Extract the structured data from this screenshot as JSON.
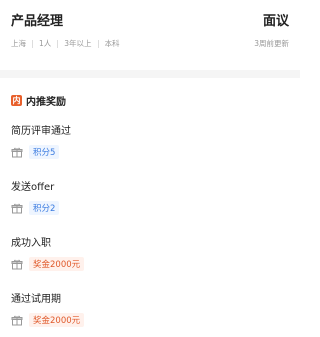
{
  "header": {
    "title": "产品经理",
    "salary": "面议",
    "meta": [
      "上海",
      "1人",
      "3年以上",
      "本科"
    ],
    "updated": "3周前更新"
  },
  "section": {
    "icon_text": "内",
    "title": "内推奖励"
  },
  "stages": [
    {
      "label": "简历评审通过",
      "reward": "积分5",
      "reward_type": "points",
      "icon": "gift-icon"
    },
    {
      "label": "发送offer",
      "reward": "积分2",
      "reward_type": "points",
      "icon": "gift-icon"
    },
    {
      "label": "成功入职",
      "reward": "奖金2000元",
      "reward_type": "cash",
      "icon": "gift-icon"
    },
    {
      "label": "通过试用期",
      "reward": "奖金2000元",
      "reward_type": "cash",
      "icon": "gift-icon"
    }
  ],
  "colors": {
    "points_text": "#3a7be0",
    "points_bg": "#eef5ff",
    "cash_text": "#e05a2b",
    "cash_bg": "#fff1ec",
    "section_icon": "#e8602c"
  }
}
